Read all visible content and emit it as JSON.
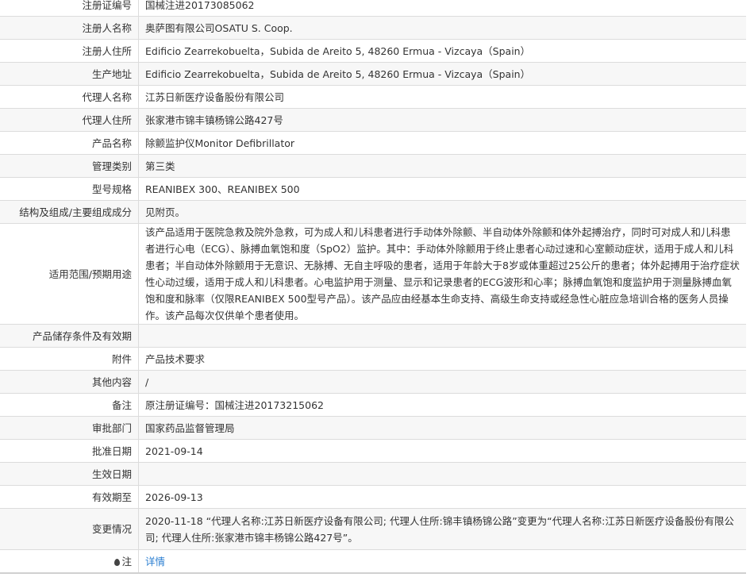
{
  "rows": [
    {
      "label": "注册证编号",
      "value": "国械注进20173085062"
    },
    {
      "label": "注册人名称",
      "value": "奥萨图有限公司OSATU S. Coop."
    },
    {
      "label": "注册人住所",
      "value": "Edificio Zearrekobuelta，Subida de Areito 5, 48260 Ermua - Vizcaya（Spain）"
    },
    {
      "label": "生产地址",
      "value": "Edificio Zearrekobuelta，Subida de Areito 5, 48260 Ermua - Vizcaya（Spain）"
    },
    {
      "label": "代理人名称",
      "value": "江苏日新医疗设备股份有限公司"
    },
    {
      "label": "代理人住所",
      "value": "张家港市锦丰镇杨锦公路427号"
    },
    {
      "label": "产品名称",
      "value": "除颤监护仪Monitor Defibrillator"
    },
    {
      "label": "管理类别",
      "value": "第三类"
    },
    {
      "label": "型号规格",
      "value": "REANIBEX 300、REANIBEX 500"
    },
    {
      "label": "结构及组成/主要组成成分",
      "value": "见附页。"
    },
    {
      "label": "适用范围/预期用途",
      "value": "该产品适用于医院急救及院外急救，可为成人和儿科患者进行手动体外除颤、半自动体外除颤和体外起搏治疗，同时可对成人和儿科患者进行心电（ECG）、脉搏血氧饱和度（SpO2）监护。其中：手动体外除颤用于终止患者心动过速和心室颤动症状，适用于成人和儿科患者；半自动体外除颤用于无意识、无脉搏、无自主呼吸的患者，适用于年龄大于8岁或体重超过25公斤的患者；体外起搏用于治疗症状性心动过缓，适用于成人和儿科患者。心电监护用于测量、显示和记录患者的ECG波形和心率；脉搏血氧饱和度监护用于测量脉搏血氧饱和度和脉率（仅限REANIBEX 500型号产品）。该产品应由经基本生命支持、高级生命支持或经急性心脏应急培训合格的医务人员操作。该产品每次仅供单个患者使用。"
    },
    {
      "label": "产品储存条件及有效期",
      "value": ""
    },
    {
      "label": "附件",
      "value": "产品技术要求"
    },
    {
      "label": "其他内容",
      "value": "/"
    },
    {
      "label": "备注",
      "value": "原注册证编号：国械注进20173215062"
    },
    {
      "label": "审批部门",
      "value": "国家药品监督管理局"
    },
    {
      "label": "批准日期",
      "value": "2021-09-14"
    },
    {
      "label": "生效日期",
      "value": ""
    },
    {
      "label": "有效期至",
      "value": "2026-09-13"
    },
    {
      "label": "变更情况",
      "value": "2020-11-18 “代理人名称:江苏日新医疗设备有限公司; 代理人住所:锦丰镇杨锦公路”变更为“代理人名称:江苏日新医疗设备股份有限公司; 代理人住所:张家港市锦丰杨锦公路427号”。"
    }
  ],
  "note": {
    "label": "注",
    "link": "详情"
  }
}
